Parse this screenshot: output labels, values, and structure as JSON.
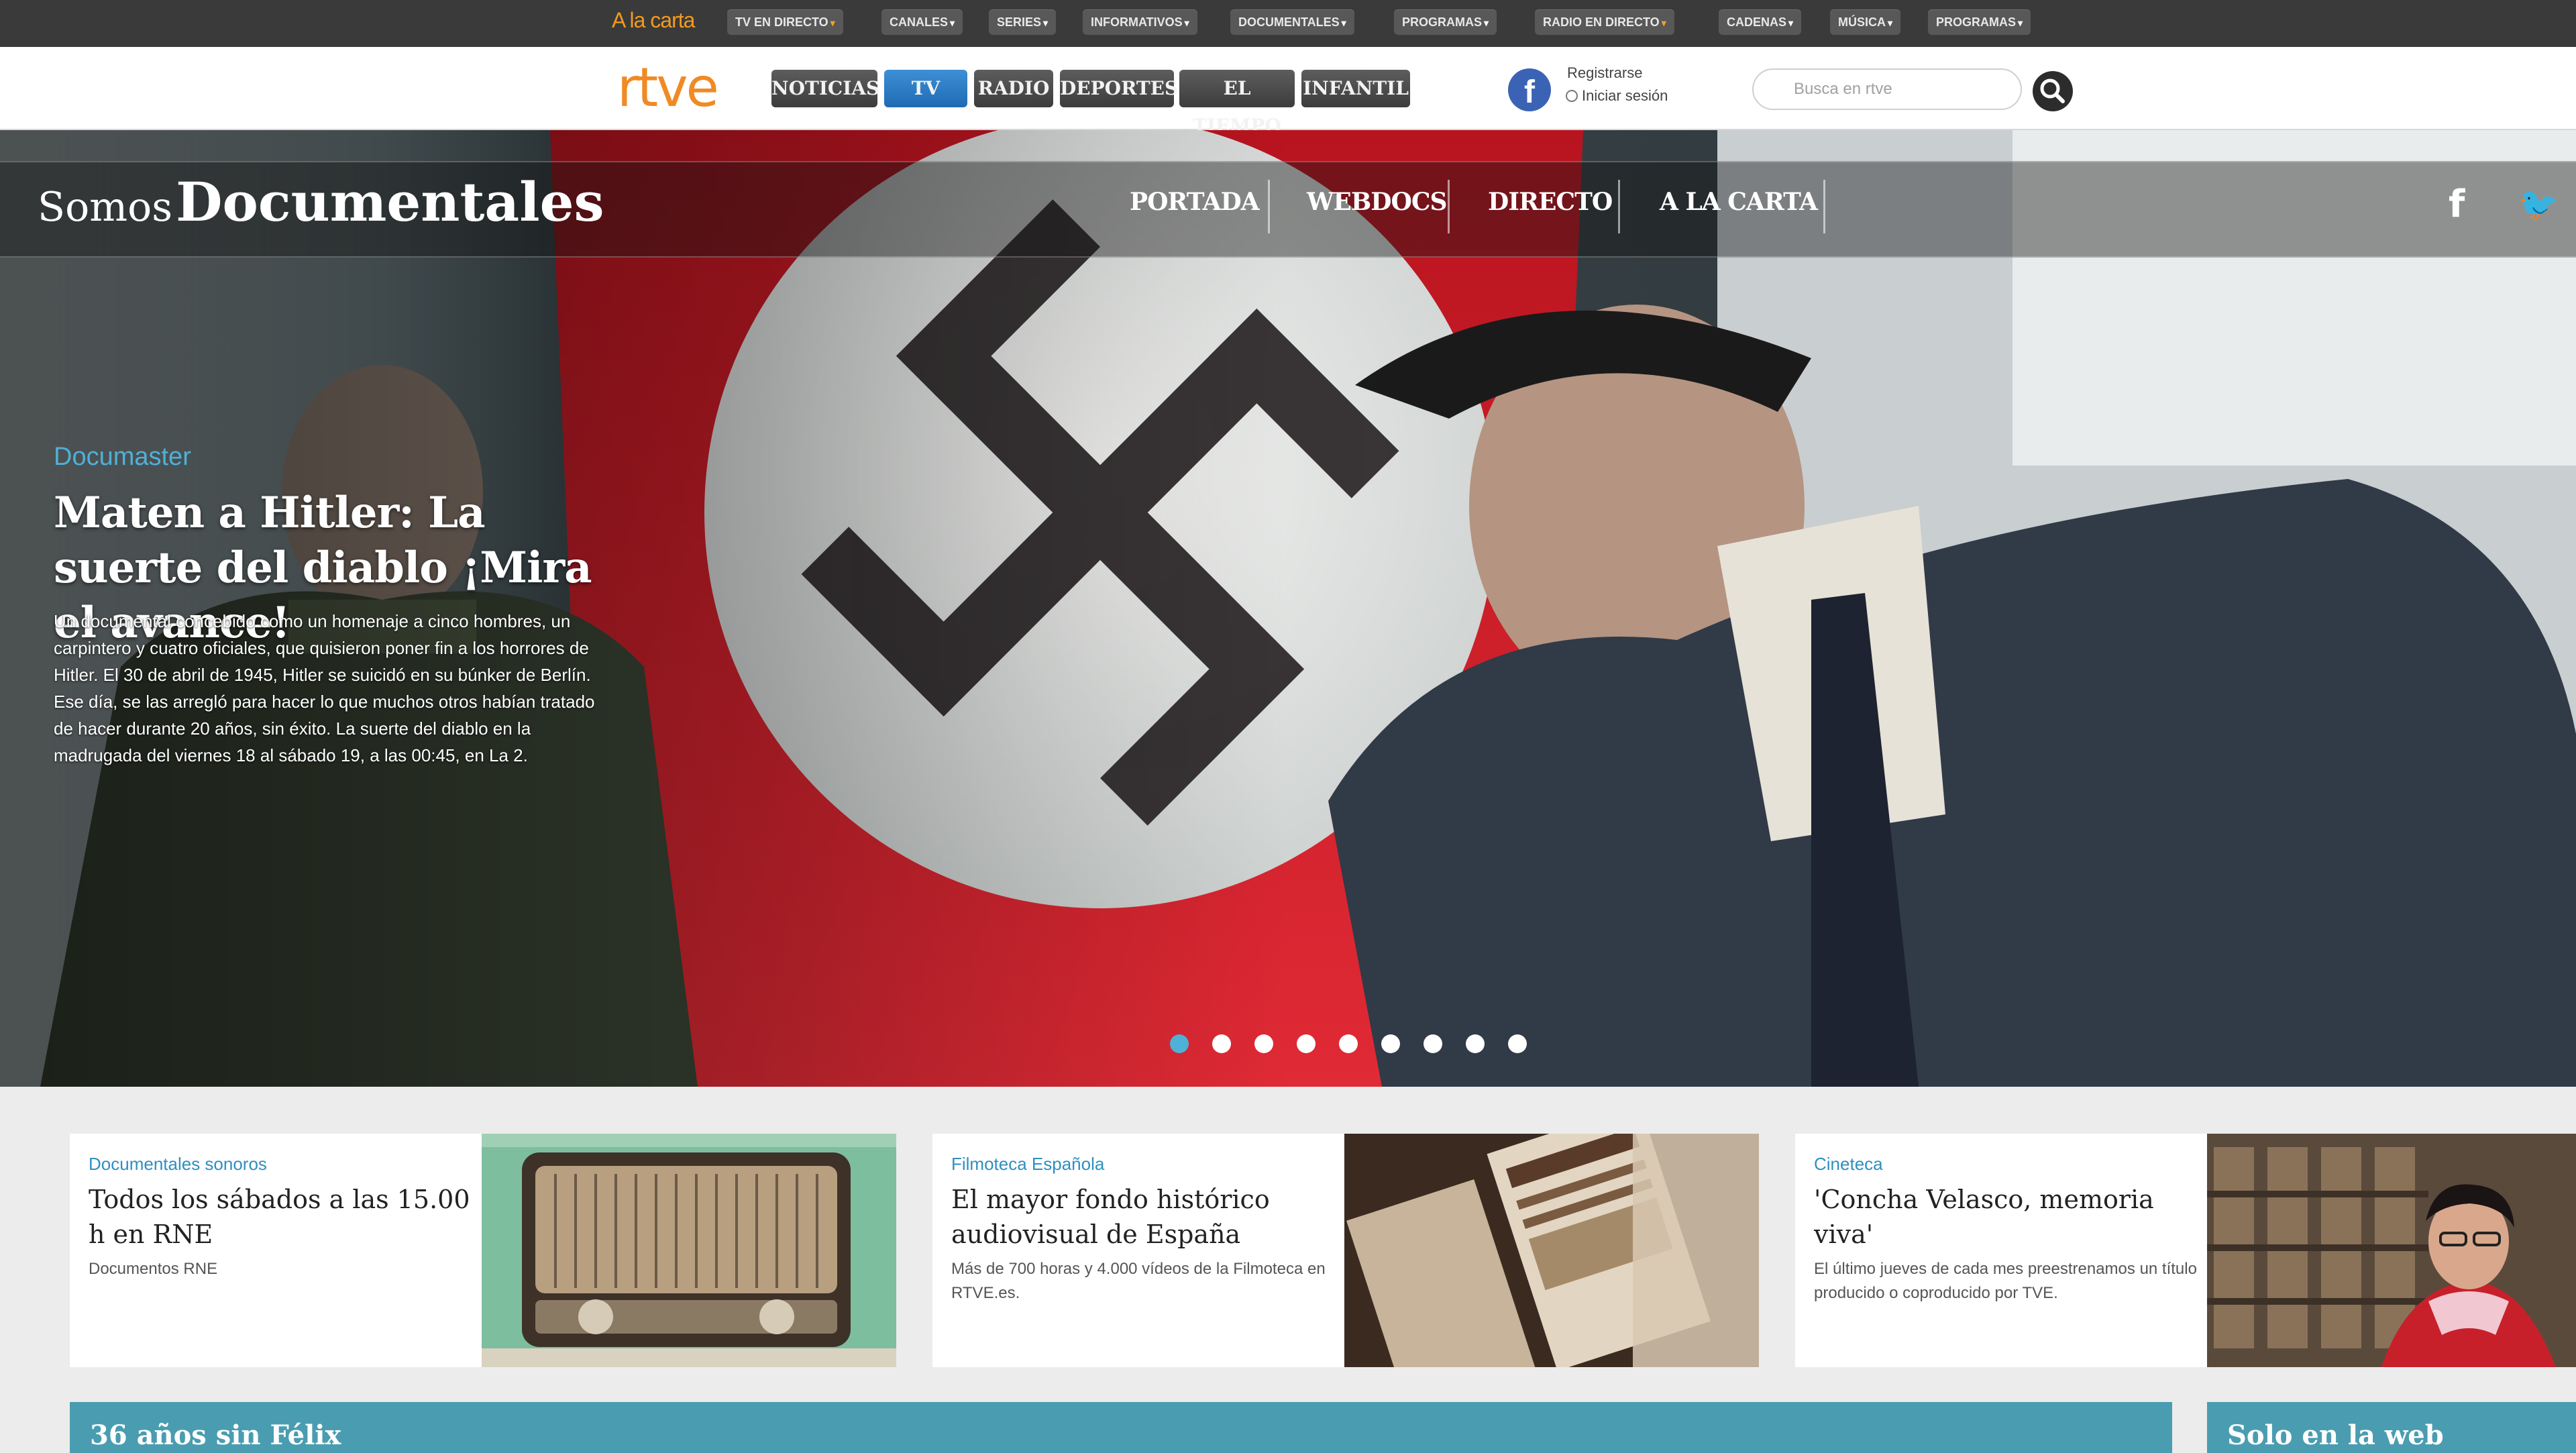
{
  "topbar": {
    "alacarta": "A la carta",
    "items": [
      {
        "label": "TV EN DIRECTO",
        "caret": "▾"
      },
      {
        "label": "CANALES",
        "caret": "▾"
      },
      {
        "label": "SERIES",
        "caret": "▾"
      },
      {
        "label": "INFORMATIVOS",
        "caret": "▾"
      },
      {
        "label": "DOCUMENTALES",
        "caret": "▾"
      },
      {
        "label": "PROGRAMAS",
        "caret": "▾"
      },
      {
        "label": "RADIO EN DIRECTO",
        "caret": "▾"
      },
      {
        "label": "CADENAS",
        "caret": "▾"
      },
      {
        "label": "MÚSICA",
        "caret": "▾"
      },
      {
        "label": "PROGRAMAS",
        "caret": "▾"
      }
    ]
  },
  "header": {
    "logo": "rtve",
    "nav": [
      "NOTICIAS",
      "TV",
      "RADIO",
      "DEPORTES",
      "EL TIEMPO",
      "INFANTIL"
    ],
    "facebook_glyph": "f",
    "register": "Registrarse",
    "login": "Iniciar sesión",
    "search_placeholder": "Busca en rtve"
  },
  "section": {
    "brand_light": "Somos",
    "brand_bold": "Documentales",
    "nav": [
      "PORTADA",
      "WEBDOCS",
      "DIRECTO",
      "A LA CARTA"
    ],
    "social_facebook": "f",
    "social_twitter": "🐦"
  },
  "hero": {
    "kicker": "Documaster",
    "headline": "Maten a Hitler: La suerte del diablo ¡Mira el avance!",
    "description": "Un documental concebido como un homenaje a cinco hombres, un carpintero y cuatro oficiales, que quisieron poner fin a los horrores de Hitler. El 30 de abril de 1945, Hitler se suicidó en su búnker de Berlín. Ese día, se las arregló para hacer lo que muchos otros habían tratado de hacer durante 20 años, sin éxito. La suerte del diablo en la madrugada del viernes 18 al sábado 19, a las 00:45, en La 2.",
    "slides": 9,
    "active_slide": 1
  },
  "cards": [
    {
      "tag": "Documentales sonoros",
      "title": "Todos los sábados a las 15.00 h en RNE",
      "sub": "Documentos RNE"
    },
    {
      "tag": "Filmoteca Española",
      "title": "El mayor fondo histórico audiovisual de España",
      "sub": "Más de 700 horas y 4.000 vídeos de la Filmoteca en RTVE.es."
    },
    {
      "tag": "Cineteca",
      "title": "'Concha Velasco, memoria viva'",
      "sub": "El último jueves de cada mes preestrenamos un título producido o coproducido por TVE."
    }
  ],
  "bottom": {
    "left": "36 años sin Félix",
    "right": "Solo en la web"
  },
  "colors": {
    "accent_blue": "#4fb0d8",
    "rtve_orange": "#f08a24",
    "bar_teal": "#4a9db0"
  }
}
